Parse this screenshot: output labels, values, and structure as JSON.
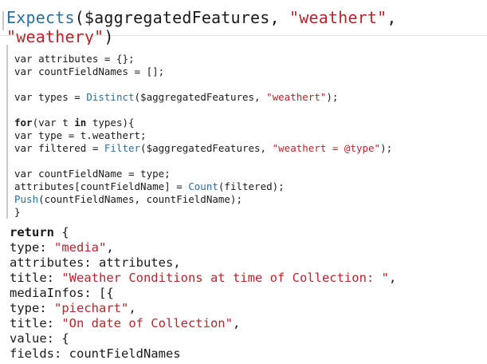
{
  "header": {
    "tokens": [
      {
        "t": "Expects",
        "k": "fn"
      },
      {
        "t": "($aggregatedFeatures, ",
        "k": "plain"
      },
      {
        "t": "\"weathert\"",
        "k": "str"
      },
      {
        "t": ", ",
        "k": "plain"
      },
      {
        "t": "\"weathery\"",
        "k": "str"
      },
      {
        "t": ")",
        "k": "plain"
      }
    ]
  },
  "block": {
    "lines": [
      [
        {
          "t": "var attributes = {};",
          "k": "plain"
        }
      ],
      [
        {
          "t": "var countFieldNames = [];",
          "k": "plain"
        }
      ],
      [
        {
          "t": "",
          "k": "plain"
        }
      ],
      [
        {
          "t": "var types = ",
          "k": "plain"
        },
        {
          "t": "Distinct",
          "k": "fn"
        },
        {
          "t": "($aggregatedFeatures, ",
          "k": "plain"
        },
        {
          "t": "\"weathert\"",
          "k": "str"
        },
        {
          "t": ");",
          "k": "plain"
        }
      ],
      [
        {
          "t": "",
          "k": "plain"
        }
      ],
      [
        {
          "t": "for",
          "k": "kw"
        },
        {
          "t": "(var t ",
          "k": "plain"
        },
        {
          "t": "in",
          "k": "kw"
        },
        {
          "t": " types){",
          "k": "plain"
        }
      ],
      [
        {
          "t": "  var type = t.weathert;",
          "k": "plain"
        }
      ],
      [
        {
          "t": "  var filtered = ",
          "k": "plain"
        },
        {
          "t": "Filter",
          "k": "fn"
        },
        {
          "t": "($aggregatedFeatures, ",
          "k": "plain"
        },
        {
          "t": "\"weathert = @type\"",
          "k": "str"
        },
        {
          "t": ");",
          "k": "plain"
        }
      ],
      [
        {
          "t": "",
          "k": "plain"
        }
      ],
      [
        {
          "t": "  var countFieldName = type;",
          "k": "plain"
        }
      ],
      [
        {
          "t": "  attributes[countFieldName] = ",
          "k": "plain"
        },
        {
          "t": "Count",
          "k": "fn"
        },
        {
          "t": "(filtered);",
          "k": "plain"
        }
      ],
      [
        {
          "t": "  ",
          "k": "plain"
        },
        {
          "t": "Push",
          "k": "fn"
        },
        {
          "t": "(countFieldNames, countFieldName);",
          "k": "plain"
        }
      ],
      [
        {
          "t": "}",
          "k": "plain"
        }
      ]
    ]
  },
  "ret": {
    "lines": [
      [
        {
          "t": "return",
          "k": "kw"
        },
        {
          "t": " {",
          "k": "plain"
        }
      ],
      [
        {
          "t": "  type: ",
          "k": "plain"
        },
        {
          "t": "\"media\"",
          "k": "str"
        },
        {
          "t": ",",
          "k": "plain"
        }
      ],
      [
        {
          "t": "  attributes: attributes,",
          "k": "plain"
        }
      ],
      [
        {
          "t": "  title: ",
          "k": "plain"
        },
        {
          "t": "\"Weather Conditions at time of Collection: \"",
          "k": "str"
        },
        {
          "t": ",",
          "k": "plain"
        }
      ],
      [
        {
          "t": "  mediaInfos: [{",
          "k": "plain"
        }
      ],
      [
        {
          "t": "    type: ",
          "k": "plain"
        },
        {
          "t": "\"piechart\"",
          "k": "str"
        },
        {
          "t": ",",
          "k": "plain"
        }
      ],
      [
        {
          "t": "    title: ",
          "k": "plain"
        },
        {
          "t": "\"On date of Collection\"",
          "k": "str"
        },
        {
          "t": ",",
          "k": "plain"
        }
      ],
      [
        {
          "t": "    value: {",
          "k": "plain"
        }
      ],
      [
        {
          "t": "      fields: countFieldNames",
          "k": "plain"
        }
      ]
    ]
  },
  "colors": {
    "function": "#2a6f9e",
    "string": "#b8252c",
    "text": "#1a1a1a"
  }
}
